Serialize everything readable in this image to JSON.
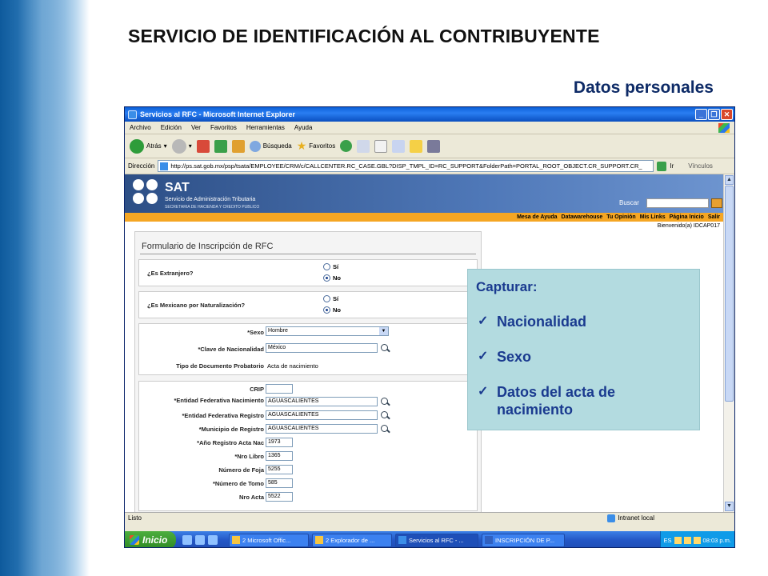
{
  "slide": {
    "title": "SERVICIO DE IDENTIFICACIÓN AL CONTRIBUYENTE",
    "subtitle": "Datos personales"
  },
  "browser": {
    "window_title": "Servicios al RFC - Microsoft Internet Explorer",
    "menu": [
      "Archivo",
      "Edición",
      "Ver",
      "Favoritos",
      "Herramientas",
      "Ayuda"
    ],
    "toolbar": {
      "back": "Atrás",
      "search": "Búsqueda",
      "favorites": "Favoritos"
    },
    "address_label": "Dirección",
    "address_url": "http://ps.sat.gob.mx/psp/tsata/EMPLOYEE/CRM/c/CALLCENTER.RC_CASE.GBL?DISP_TMPL_ID=RC_SUPPORT&FolderPath=PORTAL_ROOT_OBJECT.CR_SUPPORT.CR_",
    "go_label": "Ir",
    "links_label": "Vínculos",
    "status_text": "Listo",
    "zone_text": "Intranet local"
  },
  "sat": {
    "logo": "SAT",
    "org_name": "Servicio de Administración Tributaria",
    "org_sub": "SECRETARIA DE HACIENDA Y CREDITO PUBLICO",
    "search_label": "Buscar",
    "nav": [
      "Mesa de Ayuda",
      "Datawarehouse",
      "Tu Opinión",
      "Mis Links",
      "Página Inicio",
      "Salir"
    ],
    "welcome": "Bienvenido(a) IDCAP017"
  },
  "form": {
    "title": "Formulario de Inscripción de RFC",
    "q_extranjero": "¿Es Extranjero?",
    "q_naturalizacion": "¿Es Mexicano por Naturalización?",
    "opt_si": "Sí",
    "opt_no": "No",
    "sexo_label": "*Sexo",
    "sexo_value": "Hombre",
    "nacionalidad_label": "*Clave de Nacionalidad",
    "nacionalidad_value": "México",
    "tipo_doc_label": "Tipo de Documento Probatorio",
    "tipo_doc_value": "Acta de nacimiento",
    "crip_label": "CRIP",
    "entidad_nac_label": "*Entidad Federativa Nacimiento",
    "entidad_nac_value": "AGUASCALIENTES",
    "entidad_reg_label": "*Entidad Federativa Registro",
    "entidad_reg_value": "AGUASCALIENTES",
    "municipio_label": "*Municipio de Registro",
    "municipio_value": "AGUASCALIENTES",
    "anio_label": "*Año Registro Acta Nac",
    "anio_value": "1973",
    "libro_label": "*Nro Libro",
    "libro_value": "1365",
    "foja_label": "Número de Foja",
    "foja_value": "5255",
    "tomo_label": "*Número de Tomo",
    "tomo_value": "585",
    "acta_label": "Nro Acta",
    "acta_value": "5522"
  },
  "taskbar": {
    "start": "Inicio",
    "tasks": [
      "2 Microsoft Offic...",
      "2 Explorador de ...",
      "Servicios al RFC - ...",
      "INSCRIPCIÓN DE P..."
    ],
    "lang": "ES",
    "clock": "08:03 p.m."
  },
  "callout": {
    "heading": "Capturar:",
    "items": [
      "Nacionalidad",
      "Sexo",
      "Datos del acta de nacimiento"
    ]
  }
}
